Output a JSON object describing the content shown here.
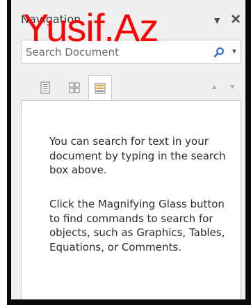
{
  "pane": {
    "title": "Navigation"
  },
  "watermark": {
    "text": "Yusif.Az"
  },
  "search": {
    "placeholder": "Search Document"
  },
  "icons": {
    "options_dropdown": "chevron-down-icon",
    "close": "close-icon",
    "search_button": "magnifying-glass-icon",
    "search_options": "chevron-down-icon",
    "tab_headings": "headings-icon",
    "tab_pages": "page-thumbnails-icon",
    "tab_results": "results-list-icon",
    "previous": "up-arrow-icon",
    "next": "down-arrow-icon"
  },
  "colors": {
    "search_icon": "#2a6cd6",
    "watermark": "#ff0000",
    "results_icon": "#e8a63a"
  },
  "results": {
    "message1": "You can search for text in your document by typing in the search box above.",
    "message2": "Click the Magnifying Glass button to find commands to search for objects, such as Graphics, Tables, Equations, or Comments."
  }
}
